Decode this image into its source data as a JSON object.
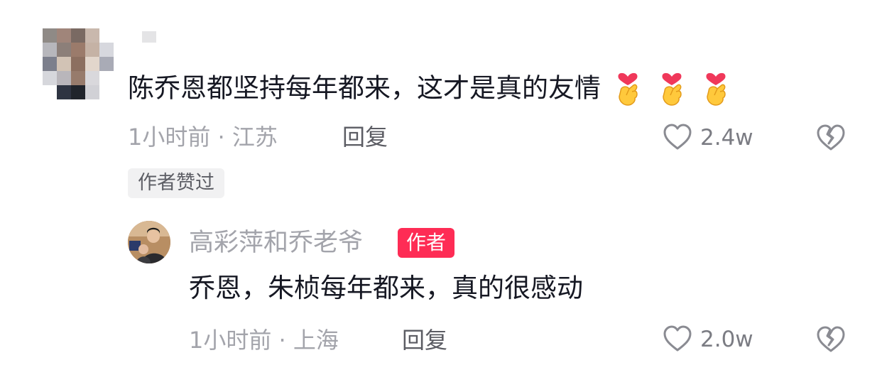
{
  "comment": {
    "text": "陈乔恩都坚持每年都来，这才是真的友情",
    "emojis": [
      "finger-heart-emoji",
      "finger-heart-emoji",
      "finger-heart-emoji"
    ],
    "time_location": "1小时前 · 江苏",
    "reply_label": "回复",
    "likes": "2.4w",
    "author_liked_badge": "作者赞过"
  },
  "reply": {
    "username": "高彩萍和乔老爷",
    "author_badge": "作者",
    "text": "乔恩，朱桢每年都来，真的很感动",
    "time_location": "1小时前 · 上海",
    "reply_label": "回复",
    "likes": "2.0w"
  },
  "colors": {
    "text": "#161823",
    "meta": "#a3a4ab",
    "author_badge_bg": "#fe2c55",
    "liked_badge_bg": "#f1f1f2"
  }
}
